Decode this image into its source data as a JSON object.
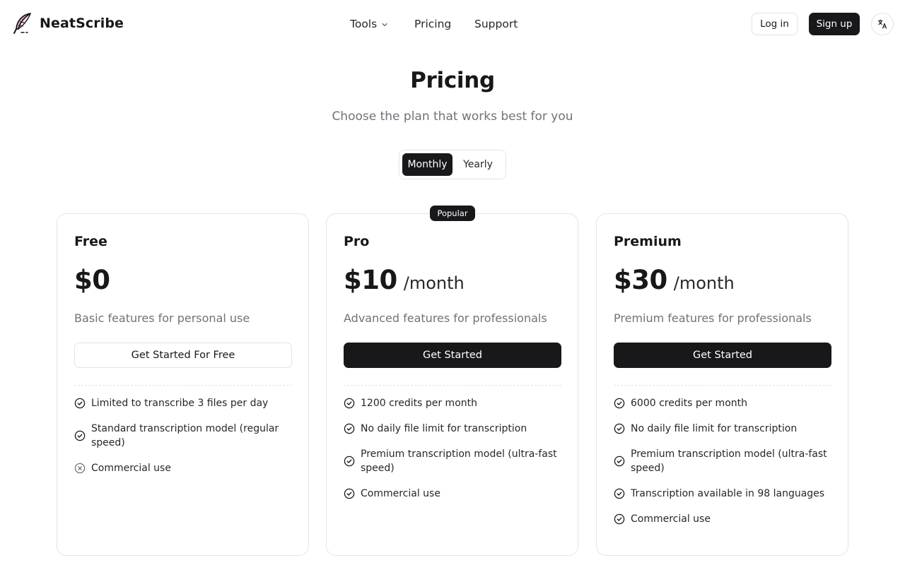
{
  "brand": {
    "name": "NeatScribe"
  },
  "nav": {
    "tools": "Tools",
    "pricing": "Pricing",
    "support": "Support"
  },
  "auth": {
    "login": "Log in",
    "signup": "Sign up"
  },
  "hero": {
    "title": "Pricing",
    "subtitle": "Choose the plan that works best for you"
  },
  "billing": {
    "monthly": "Monthly",
    "yearly": "Yearly",
    "selected": "Monthly"
  },
  "badge": "Popular",
  "plans": [
    {
      "name": "Free",
      "price": "$0",
      "period": "",
      "description": "Basic features for personal use",
      "cta": "Get Started For Free",
      "features": [
        {
          "text": "Limited to transcribe 3 files per day",
          "icon": "check-circle-icon"
        },
        {
          "text": "Standard transcription model (regular speed)",
          "icon": "check-circle-icon"
        },
        {
          "text": "Commercial use",
          "icon": "x-circle-icon"
        }
      ]
    },
    {
      "name": "Pro",
      "price": "$10",
      "period": "/month",
      "description": "Advanced features for professionals",
      "cta": "Get Started",
      "features": [
        {
          "text": "1200 credits per month",
          "icon": "check-circle-icon"
        },
        {
          "text": "No daily file limit for transcription",
          "icon": "check-circle-icon"
        },
        {
          "text": "Premium transcription model (ultra-fast speed)",
          "icon": "check-circle-icon"
        },
        {
          "text": "Commercial use",
          "icon": "check-circle-icon"
        }
      ]
    },
    {
      "name": "Premium",
      "price": "$30",
      "period": "/month",
      "description": "Premium features for professionals",
      "cta": "Get Started",
      "features": [
        {
          "text": "6000 credits per month",
          "icon": "check-circle-icon"
        },
        {
          "text": "No daily file limit for transcription",
          "icon": "check-circle-icon"
        },
        {
          "text": "Premium transcription model (ultra-fast speed)",
          "icon": "check-circle-icon"
        },
        {
          "text": "Transcription available in 98 languages",
          "icon": "check-circle-icon"
        },
        {
          "text": "Commercial use",
          "icon": "check-circle-icon"
        }
      ]
    }
  ],
  "colors": {
    "primary": "#18181b",
    "muted_text": "#71717a",
    "border": "#e4e4e7",
    "logo_feather": "#f9a8d4"
  }
}
